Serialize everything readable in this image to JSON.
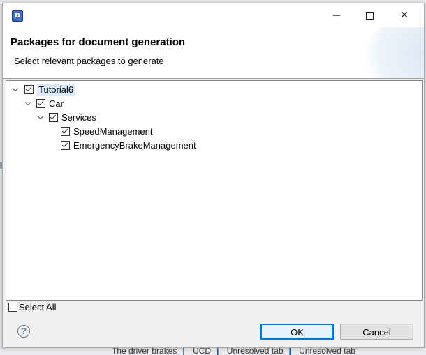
{
  "background_app": {
    "bottom_tabs": [
      "The driver brakes",
      "UCD",
      "Unresolved tab",
      "Unresolved tab"
    ]
  },
  "dialog": {
    "app_icon_letter": "D",
    "title": "Packages for document generation",
    "description": "Select relevant packages to generate",
    "tree": [
      {
        "label": "Tutorial6",
        "checked": true,
        "expanded": true,
        "selected": true
      },
      {
        "label": "Car",
        "checked": true,
        "expanded": true
      },
      {
        "label": "Services",
        "checked": true,
        "expanded": true
      },
      {
        "label": "SpeedManagement",
        "checked": true
      },
      {
        "label": "EmergencyBrakeManagement",
        "checked": true
      }
    ],
    "select_all_label": "Select All",
    "help_glyph": "?",
    "ok_label": "OK",
    "cancel_label": "Cancel"
  }
}
